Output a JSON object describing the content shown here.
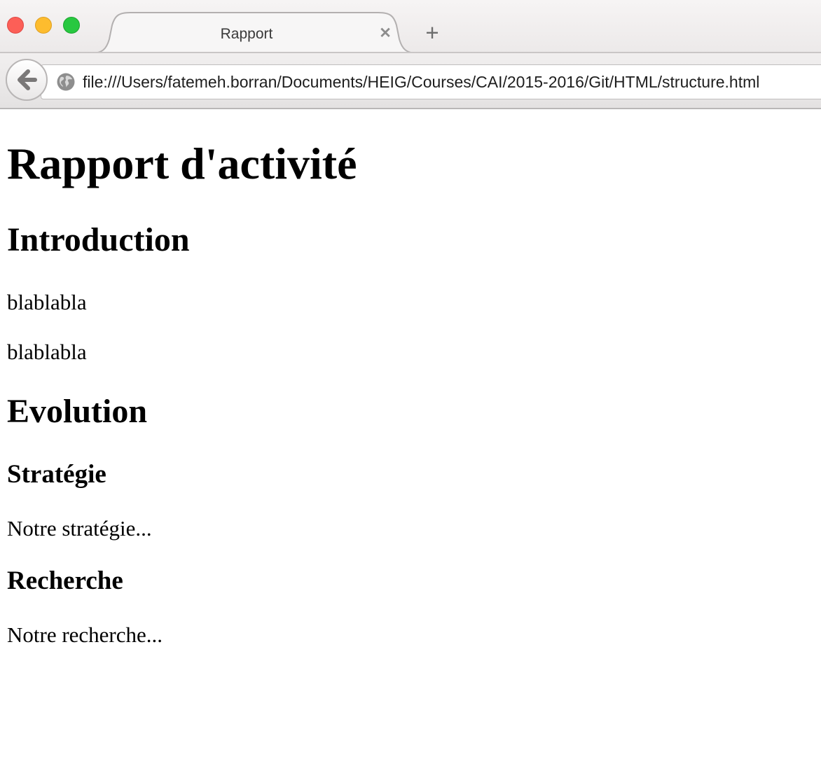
{
  "window": {
    "controls": [
      "close-button",
      "minimize-button",
      "zoom-button"
    ]
  },
  "tab": {
    "title": "Rapport",
    "close_glyph": "✕",
    "new_tab_glyph": "+"
  },
  "navbar": {
    "back_icon": "back-arrow-icon",
    "site_icon": "globe-icon",
    "url": "file:///Users/fatemeh.borran/Documents/HEIG/Courses/CAI/2015-2016/Git/HTML/structure.html"
  },
  "page": {
    "title": "Rapport d'activité",
    "sections": [
      {
        "heading": "Introduction",
        "paragraphs": [
          "blablabla",
          "blablabla"
        ]
      },
      {
        "heading": "Evolution",
        "subsections": [
          {
            "heading": "Stratégie",
            "paragraph": "Notre stratégie..."
          },
          {
            "heading": "Recherche",
            "paragraph": "Notre recherche..."
          }
        ]
      }
    ]
  },
  "colors": {
    "close": "#fc5f57",
    "minimize": "#fdbc2e",
    "zoom": "#28c840"
  }
}
